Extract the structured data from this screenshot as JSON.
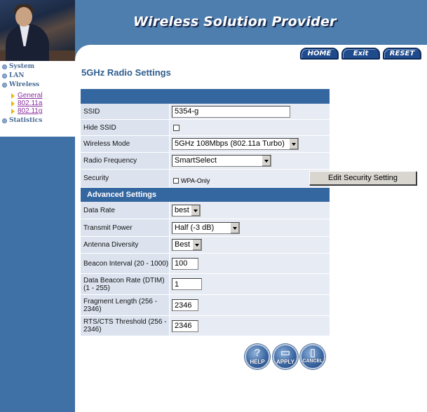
{
  "header": {
    "title": "Wireless Solution Provider",
    "nav": {
      "home": "HOME",
      "exit": "Exit",
      "reset": "RESET"
    }
  },
  "sidebar": {
    "items": [
      {
        "label": "System"
      },
      {
        "label": "LAN"
      },
      {
        "label": "Wireless"
      },
      {
        "label": "Statistics"
      }
    ],
    "wireless_sub": [
      {
        "label": "General"
      },
      {
        "label": "802.11a"
      },
      {
        "label": "802.11g"
      }
    ]
  },
  "page_title": "5GHz Radio Settings",
  "form": {
    "ssid": {
      "label": "SSID",
      "value": "5354-g"
    },
    "hide_ssid": {
      "label": "Hide SSID",
      "checked": false
    },
    "wireless_mode": {
      "label": "Wireless Mode",
      "value": "5GHz 108Mbps (802.11a Turbo)"
    },
    "radio_frequency": {
      "label": "Radio Frequency",
      "value": "SmartSelect"
    },
    "security": {
      "label": "Security",
      "wpa_only_label": "WPA-Only",
      "wpa_only_checked": false,
      "edit_button": "Edit Security Setting"
    },
    "advanced_header": "Advanced Settings",
    "data_rate": {
      "label": "Data Rate",
      "value": "best"
    },
    "transmit_power": {
      "label": "Transmit Power",
      "value": "Half (-3 dB)"
    },
    "antenna_diversity": {
      "label": "Antenna Diversity",
      "value": "Best"
    },
    "beacon_interval": {
      "label": "Beacon Interval (20 - 1000)",
      "value": "100"
    },
    "dtim": {
      "label": "Data Beacon Rate (DTIM) (1 - 255)",
      "value": "1"
    },
    "fragment_length": {
      "label": "Fragment Length (256 - 2346)",
      "value": "2346"
    },
    "rts_threshold": {
      "label": "RTS/CTS Threshold (256 - 2346)",
      "value": "2346"
    }
  },
  "actions": {
    "help": "HELP",
    "apply": "APPLY",
    "cancel": "CANCEL"
  },
  "icons": {
    "help": "question-icon",
    "apply": "document-icon",
    "cancel": "trash-icon"
  },
  "colors": {
    "header_bg": "#4d7eae",
    "sidebar_bg": "#3f70a6",
    "section_bar": "#3466a0",
    "title_text": "#2f5d8e"
  }
}
